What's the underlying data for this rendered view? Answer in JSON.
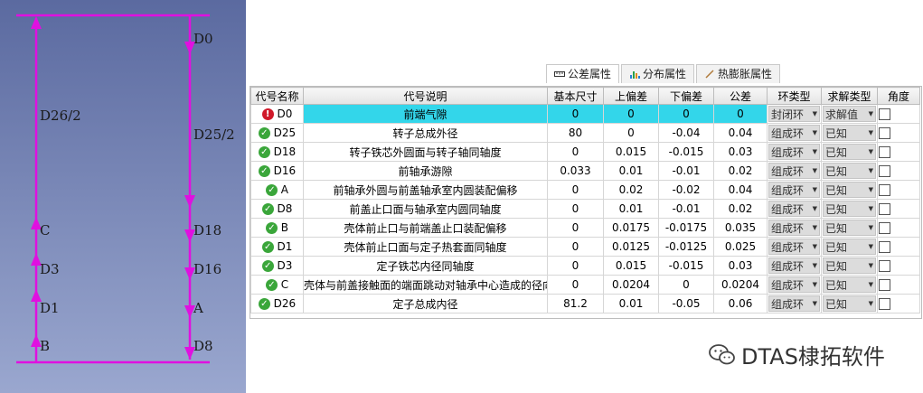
{
  "diagram": {
    "labels": {
      "d0": "D0",
      "d26_2": "D26/2",
      "d25_2": "D25/2",
      "c": "C",
      "d3": "D3",
      "d1": "D1",
      "b": "B",
      "d18": "D18",
      "d16": "D16",
      "a": "A",
      "d8": "D8"
    },
    "line_color": "#e010e0"
  },
  "tabs": [
    {
      "label": "公差属性",
      "icon": "ruler-icon",
      "active": true
    },
    {
      "label": "分布属性",
      "icon": "histogram-icon",
      "active": false
    },
    {
      "label": "热膨胀属性",
      "icon": "pen-icon",
      "active": false
    }
  ],
  "table": {
    "headers": {
      "code": "代号名称",
      "desc": "代号说明",
      "nominal": "基本尺寸",
      "upper": "上偏差",
      "lower": "下偏差",
      "tol": "公差",
      "ring_type": "环类型",
      "solve_type": "求解类型",
      "angle": "角度"
    },
    "rows": [
      {
        "status": "error",
        "code": "D0",
        "desc": "前端气隙",
        "nominal": "0",
        "upper": "0",
        "lower": "0",
        "tol": "0",
        "ring_type": "封闭环",
        "solve_type": "求解值",
        "selected": true
      },
      {
        "status": "ok",
        "code": "D25",
        "desc": "转子总成外径",
        "nominal": "80",
        "upper": "0",
        "lower": "-0.04",
        "tol": "0.04",
        "ring_type": "组成环",
        "solve_type": "已知",
        "selected": false
      },
      {
        "status": "ok",
        "code": "D18",
        "desc": "转子铁芯外圆面与转子轴同轴度",
        "nominal": "0",
        "upper": "0.015",
        "lower": "-0.015",
        "tol": "0.03",
        "ring_type": "组成环",
        "solve_type": "已知",
        "selected": false
      },
      {
        "status": "ok",
        "code": "D16",
        "desc": "前轴承游隙",
        "nominal": "0.033",
        "upper": "0.01",
        "lower": "-0.01",
        "tol": "0.02",
        "ring_type": "组成环",
        "solve_type": "已知",
        "selected": false
      },
      {
        "status": "ok",
        "code": "A",
        "desc": "前轴承外圆与前盖轴承室内圆装配偏移",
        "nominal": "0",
        "upper": "0.02",
        "lower": "-0.02",
        "tol": "0.04",
        "ring_type": "组成环",
        "solve_type": "已知",
        "selected": false
      },
      {
        "status": "ok",
        "code": "D8",
        "desc": "前盖止口面与轴承室内圆同轴度",
        "nominal": "0",
        "upper": "0.01",
        "lower": "-0.01",
        "tol": "0.02",
        "ring_type": "组成环",
        "solve_type": "已知",
        "selected": false
      },
      {
        "status": "ok",
        "code": "B",
        "desc": "壳体前止口与前端盖止口装配偏移",
        "nominal": "0",
        "upper": "0.0175",
        "lower": "-0.0175",
        "tol": "0.035",
        "ring_type": "组成环",
        "solve_type": "已知",
        "selected": false
      },
      {
        "status": "ok",
        "code": "D1",
        "desc": "壳体前止口面与定子热套面同轴度",
        "nominal": "0",
        "upper": "0.0125",
        "lower": "-0.0125",
        "tol": "0.025",
        "ring_type": "组成环",
        "solve_type": "已知",
        "selected": false
      },
      {
        "status": "ok",
        "code": "D3",
        "desc": "定子铁芯内径同轴度",
        "nominal": "0",
        "upper": "0.015",
        "lower": "-0.015",
        "tol": "0.03",
        "ring_type": "组成环",
        "solve_type": "已知",
        "selected": false
      },
      {
        "status": "ok",
        "code": "C",
        "desc": "壳体与前盖接触面的端面跳动对轴承中心造成的径向偏差",
        "nominal": "0",
        "upper": "0.0204",
        "lower": "0",
        "tol": "0.0204",
        "ring_type": "组成环",
        "solve_type": "已知",
        "selected": false
      },
      {
        "status": "ok",
        "code": "D26",
        "desc": "定子总成内径",
        "nominal": "81.2",
        "upper": "0.01",
        "lower": "-0.05",
        "tol": "0.06",
        "ring_type": "组成环",
        "solve_type": "已知",
        "selected": false
      }
    ]
  },
  "watermark": {
    "text": "DTAS棣拓软件",
    "icon": "wechat-icon"
  }
}
